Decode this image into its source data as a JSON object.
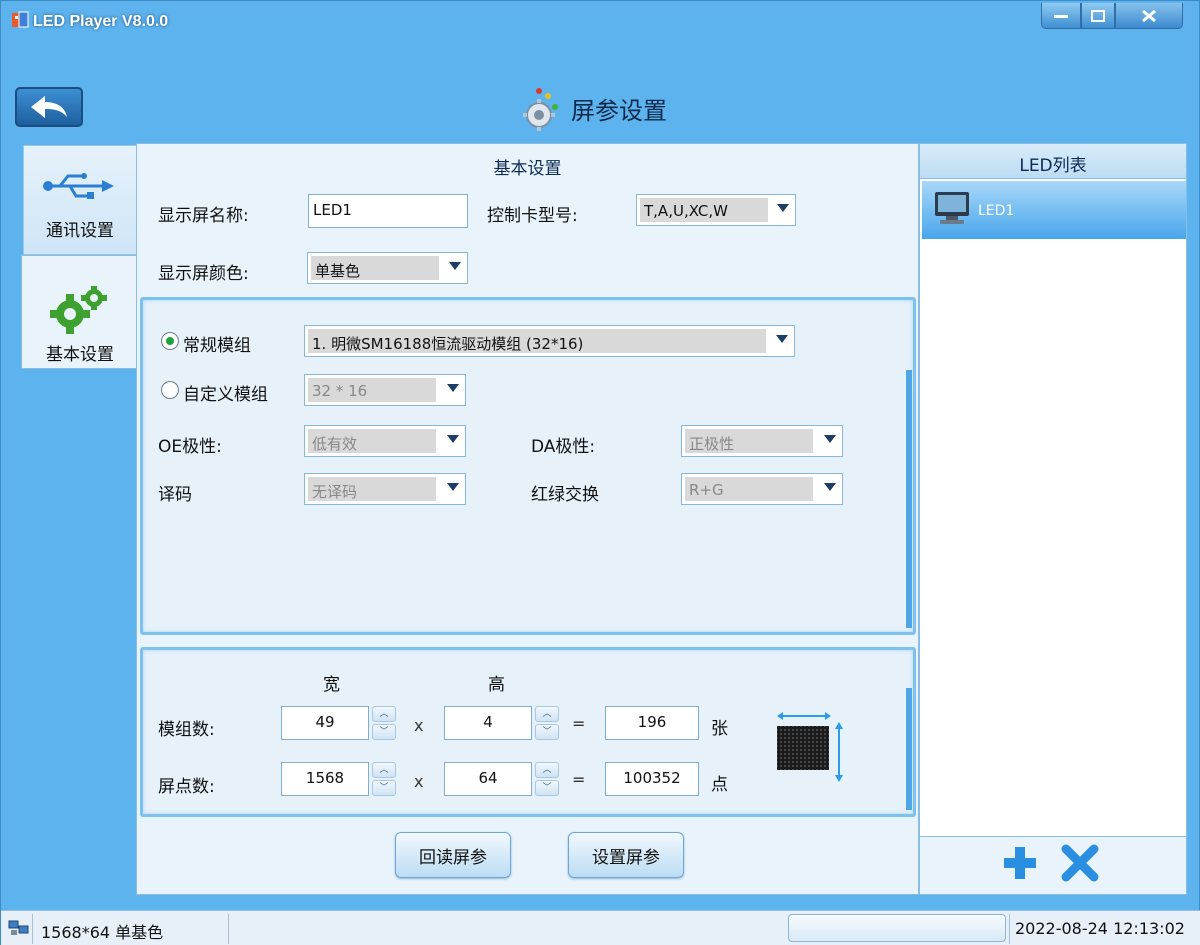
{
  "window": {
    "title": "LED Player V8.0.0"
  },
  "header": {
    "title": "屏参设置"
  },
  "tabs": [
    {
      "label": "通讯设置",
      "icon": "usb-icon"
    },
    {
      "label": "基本设置",
      "icon": "gears-icon"
    }
  ],
  "basic": {
    "section_title": "基本设置",
    "screen_name_label": "显示屏名称:",
    "screen_name_value": "LED1",
    "card_model_label": "控制卡型号:",
    "card_model_value": "T,A,U,XC,W",
    "screen_color_label": "显示屏颜色:",
    "screen_color_value": "单基色"
  },
  "module": {
    "standard_label": "常规模组",
    "standard_value": "1. 明微SM16188恒流驱动模组 (32*16)",
    "custom_label": "自定义模组",
    "custom_value": "32 * 16",
    "oe_label": "OE极性:",
    "oe_value": "低有效",
    "da_label": "DA极性:",
    "da_value": "正极性",
    "decode_label": "译码",
    "decode_value": "无译码",
    "rg_label": "红绿交换",
    "rg_value": "R+G"
  },
  "size": {
    "width_header": "宽",
    "height_header": "高",
    "modules_label": "模组数:",
    "modules_w": "49",
    "modules_h": "4",
    "modules_total": "196",
    "modules_unit": "张",
    "pixels_label": "屏点数:",
    "pixels_w": "1568",
    "pixels_h": "64",
    "pixels_total": "100352",
    "pixels_unit": "点",
    "times": "x",
    "equals": "="
  },
  "buttons": {
    "readback": "回读屏参",
    "set": "设置屏参"
  },
  "led_list": {
    "title": "LED列表",
    "items": [
      "LED1"
    ]
  },
  "status": {
    "text": "1568*64 单基色",
    "time": "2022-08-24 12:13:02"
  },
  "colors": {
    "accent": "#5db3ee",
    "selected": "#48a6ec",
    "radio_on": "#1aa33a",
    "icon_blue": "#2b7fd2"
  }
}
